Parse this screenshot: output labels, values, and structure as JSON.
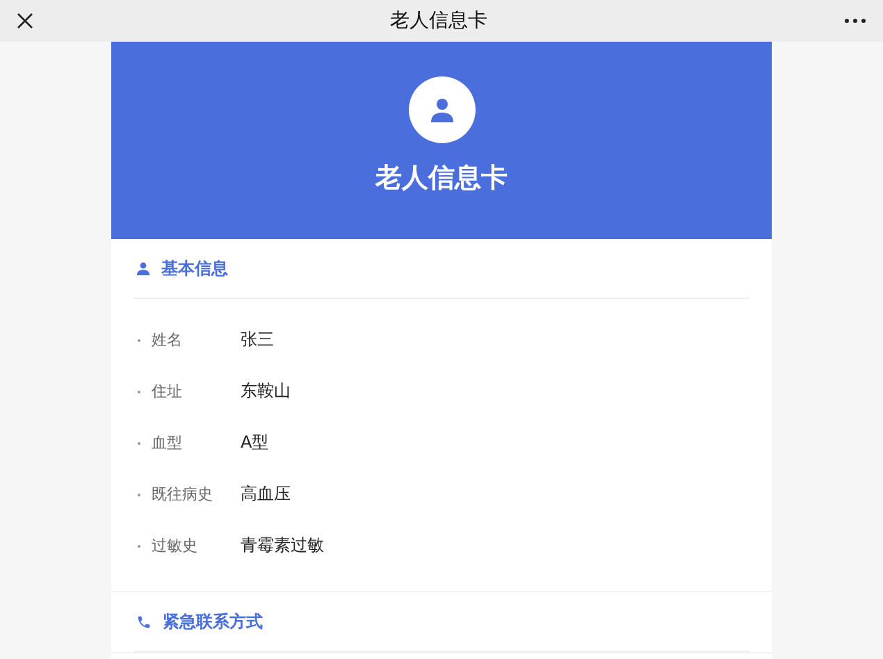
{
  "top_bar": {
    "title": "老人信息卡"
  },
  "header": {
    "title": "老人信息卡"
  },
  "sections": [
    {
      "kind": "person",
      "title": "基本信息",
      "fields": [
        {
          "label": "姓名",
          "value": "张三"
        },
        {
          "label": "住址",
          "value": "东鞍山"
        },
        {
          "label": "血型",
          "value": "A型"
        },
        {
          "label": "既往病史",
          "value": "高血压"
        },
        {
          "label": "过敏史",
          "value": "青霉素过敏"
        }
      ]
    },
    {
      "kind": "phone",
      "title": "紧急联系方式"
    }
  ]
}
